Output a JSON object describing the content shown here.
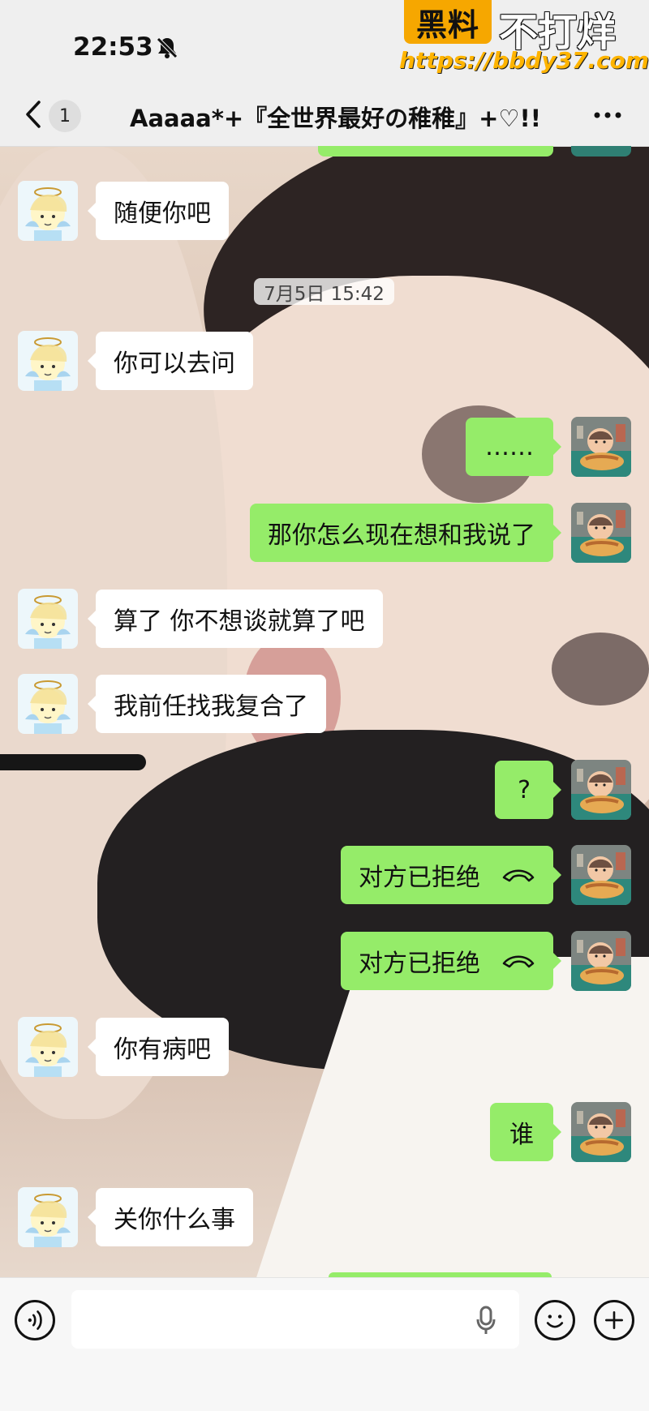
{
  "status_bar": {
    "time": "22:53"
  },
  "watermark": {
    "badge": "黑料",
    "text": "不打烊",
    "url": "https://bbdy37.com"
  },
  "header": {
    "unread_count": "1",
    "title": "Aaaaa*+『全世界最好の稚稚』+♡!!"
  },
  "chat": {
    "timestamp": "7月5日 15:42",
    "messages": [
      {
        "side": "left",
        "text": "随便你吧"
      },
      {
        "side": "left",
        "text": "你可以去问"
      },
      {
        "side": "right",
        "text": "……"
      },
      {
        "side": "right",
        "text": "那你怎么现在想和我说了"
      },
      {
        "side": "left",
        "text": "算了 你不想谈就算了吧"
      },
      {
        "side": "left",
        "text": "我前任找我复合了"
      },
      {
        "side": "right",
        "text": "?"
      },
      {
        "side": "right",
        "text": "对方已拒绝",
        "icon": "hangup-icon"
      },
      {
        "side": "right",
        "text": "对方已拒绝",
        "icon": "hangup-icon"
      },
      {
        "side": "left",
        "text": "你有病吧"
      },
      {
        "side": "right",
        "text": "谁"
      },
      {
        "side": "left",
        "text": "关你什么事"
      }
    ]
  },
  "input_bar": {
    "placeholder": ""
  },
  "colors": {
    "app_bg": "#efefef",
    "sent_bubble": "#95ec69",
    "received_bubble": "#ffffff",
    "watermark_orange": "#f6a700"
  }
}
